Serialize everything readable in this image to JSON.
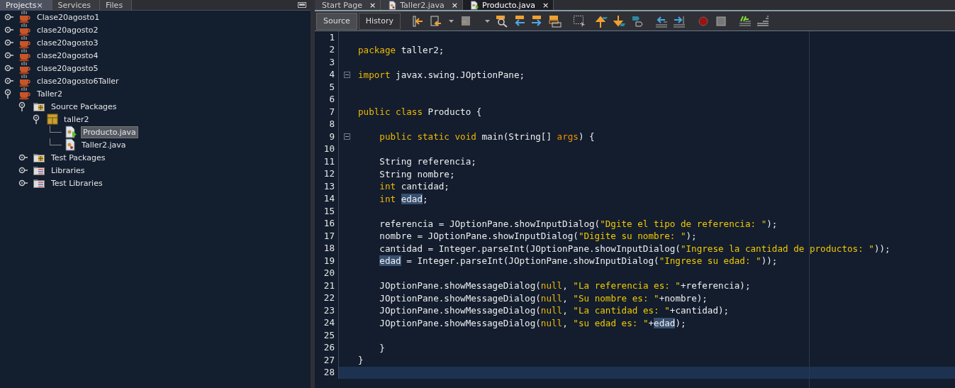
{
  "side_tabs": [
    {
      "label": "Projects",
      "close": "×",
      "selected": true
    },
    {
      "label": "Services",
      "selected": false
    },
    {
      "label": "Files",
      "selected": false
    }
  ],
  "tree": [
    {
      "label": "Clase20agosto1",
      "kind": "project",
      "expanded": false,
      "selected": false
    },
    {
      "label": "clase20agosto2",
      "kind": "project",
      "expanded": false,
      "selected": false
    },
    {
      "label": "clase20agosto3",
      "kind": "project",
      "expanded": false,
      "selected": false
    },
    {
      "label": "clase20agosto4",
      "kind": "project",
      "expanded": false,
      "selected": false
    },
    {
      "label": "clase20agosto5",
      "kind": "project",
      "expanded": false,
      "selected": false
    },
    {
      "label": "clase20agosto6Taller",
      "kind": "project",
      "expanded": false,
      "selected": false
    },
    {
      "label": "Taller2",
      "kind": "project",
      "expanded": true,
      "selected": false,
      "children": [
        {
          "label": "Source Packages",
          "kind": "source-folder",
          "expanded": true,
          "selected": false,
          "children": [
            {
              "label": "taller2",
              "kind": "package",
              "expanded": true,
              "selected": false,
              "children": [
                {
                  "label": "Producto.java",
                  "kind": "main-class",
                  "selected": true
                },
                {
                  "label": "Taller2.java",
                  "kind": "class",
                  "selected": false
                }
              ]
            }
          ]
        },
        {
          "label": "Test Packages",
          "kind": "source-folder",
          "expanded": false,
          "selected": false
        },
        {
          "label": "Libraries",
          "kind": "library",
          "expanded": false,
          "selected": false
        },
        {
          "label": "Test Libraries",
          "kind": "library",
          "expanded": false,
          "selected": false
        }
      ]
    }
  ],
  "editor_tabs": [
    {
      "label": "Start Page",
      "kind": "page",
      "close": "×",
      "selected": false
    },
    {
      "label": "Taller2.java",
      "kind": "class",
      "close": "×",
      "selected": false
    },
    {
      "label": "Producto.java",
      "kind": "main-class",
      "close": "×",
      "selected": true
    }
  ],
  "view_buttons": [
    {
      "label": "Source",
      "selected": true
    },
    {
      "label": "History",
      "selected": false
    }
  ],
  "code": [
    {
      "number": "1"
    },
    {
      "number": "2",
      "indented": false,
      "tokens": [
        {
          "text": "package",
          "kind": "keyword"
        },
        {
          "text": " taller2;",
          "kind": "plain"
        }
      ]
    },
    {
      "number": "3"
    },
    {
      "number": "4",
      "fold": true,
      "indented": false,
      "tokens": [
        {
          "text": "import",
          "kind": "keyword"
        },
        {
          "text": " javax.swing.JOptionPane;",
          "kind": "plain"
        }
      ]
    },
    {
      "number": "5"
    },
    {
      "number": "6"
    },
    {
      "number": "7",
      "indented": false,
      "tokens": [
        {
          "text": "public class",
          "kind": "keyword"
        },
        {
          "text": " Producto {",
          "kind": "plain"
        }
      ]
    },
    {
      "number": "8"
    },
    {
      "number": "9",
      "fold": true,
      "indented": true,
      "tokens": [
        {
          "text": "public static void",
          "kind": "keyword"
        },
        {
          "text": " main(String[] ",
          "kind": "plain"
        },
        {
          "text": "args",
          "kind": "parameter"
        },
        {
          "text": ") {",
          "kind": "plain"
        }
      ]
    },
    {
      "number": "10"
    },
    {
      "number": "11",
      "indented": true,
      "tokens": [
        {
          "text": "String referencia;",
          "kind": "plain"
        }
      ]
    },
    {
      "number": "12",
      "indented": true,
      "tokens": [
        {
          "text": "String nombre;",
          "kind": "plain"
        }
      ]
    },
    {
      "number": "13",
      "indented": true,
      "tokens": [
        {
          "text": "int",
          "kind": "keyword"
        },
        {
          "text": " cantidad;",
          "kind": "plain"
        }
      ]
    },
    {
      "number": "14",
      "indented": true,
      "tokens": [
        {
          "text": "int ",
          "kind": "keyword"
        },
        {
          "text": "edad",
          "kind": "occurrence"
        },
        {
          "text": ";",
          "kind": "plain"
        }
      ]
    },
    {
      "number": "15"
    },
    {
      "number": "16",
      "indented": true,
      "tokens": [
        {
          "text": "referencia = JOptionPane.showInputDialog(",
          "kind": "plain"
        },
        {
          "text": "\"Dgite el tipo de referencia: \"",
          "kind": "string"
        },
        {
          "text": ");",
          "kind": "plain"
        }
      ]
    },
    {
      "number": "17",
      "indented": true,
      "tokens": [
        {
          "text": "nombre = JOptionPane.showInputDialog(",
          "kind": "plain"
        },
        {
          "text": "\"Digite su nombre: \"",
          "kind": "string"
        },
        {
          "text": ");",
          "kind": "plain"
        }
      ]
    },
    {
      "number": "18",
      "indented": true,
      "tokens": [
        {
          "text": "cantidad = Integer.parseInt(JOptionPane.showInputDialog(",
          "kind": "plain"
        },
        {
          "text": "\"Ingrese la cantidad de productos: \"",
          "kind": "string"
        },
        {
          "text": "));",
          "kind": "plain"
        }
      ]
    },
    {
      "number": "19",
      "indented": true,
      "tokens": [
        {
          "text": "edad",
          "kind": "occurrence"
        },
        {
          "text": " = Integer.parseInt(JOptionPane.showInputDialog(",
          "kind": "plain"
        },
        {
          "text": "\"Ingrese su edad: \"",
          "kind": "string"
        },
        {
          "text": "));",
          "kind": "plain"
        }
      ]
    },
    {
      "number": "20"
    },
    {
      "number": "21",
      "indented": true,
      "tokens": [
        {
          "text": "JOptionPane.showMessageDialog(",
          "kind": "plain"
        },
        {
          "text": "null",
          "kind": "keyword"
        },
        {
          "text": ", ",
          "kind": "plain"
        },
        {
          "text": "\"La referencia es: \"",
          "kind": "string"
        },
        {
          "text": "+referencia);",
          "kind": "plain"
        }
      ]
    },
    {
      "number": "22",
      "indented": true,
      "tokens": [
        {
          "text": "JOptionPane.showMessageDialog(",
          "kind": "plain"
        },
        {
          "text": "null",
          "kind": "keyword"
        },
        {
          "text": ", ",
          "kind": "plain"
        },
        {
          "text": "\"Su nombre es: \"",
          "kind": "string"
        },
        {
          "text": "+nombre);",
          "kind": "plain"
        }
      ]
    },
    {
      "number": "23",
      "indented": true,
      "tokens": [
        {
          "text": "JOptionPane.showMessageDialog(",
          "kind": "plain"
        },
        {
          "text": "null",
          "kind": "keyword"
        },
        {
          "text": ", ",
          "kind": "plain"
        },
        {
          "text": "\"La cantidad es: \"",
          "kind": "string"
        },
        {
          "text": "+cantidad);",
          "kind": "plain"
        }
      ]
    },
    {
      "number": "24",
      "indented": true,
      "tokens": [
        {
          "text": "JOptionPane.showMessageDialog(",
          "kind": "plain"
        },
        {
          "text": "null",
          "kind": "keyword"
        },
        {
          "text": ", ",
          "kind": "plain"
        },
        {
          "text": "\"su edad es: \"",
          "kind": "string"
        },
        {
          "text": "+",
          "kind": "plain"
        },
        {
          "text": "edad",
          "kind": "occurrence"
        },
        {
          "text": ");",
          "kind": "plain"
        }
      ]
    },
    {
      "number": "25"
    },
    {
      "number": "26",
      "indented": true,
      "tokens": [
        {
          "text": "}",
          "kind": "plain"
        }
      ]
    },
    {
      "number": "27",
      "indented": false,
      "tokens": [
        {
          "text": "}",
          "kind": "plain"
        }
      ]
    },
    {
      "number": "28",
      "current": true
    }
  ]
}
